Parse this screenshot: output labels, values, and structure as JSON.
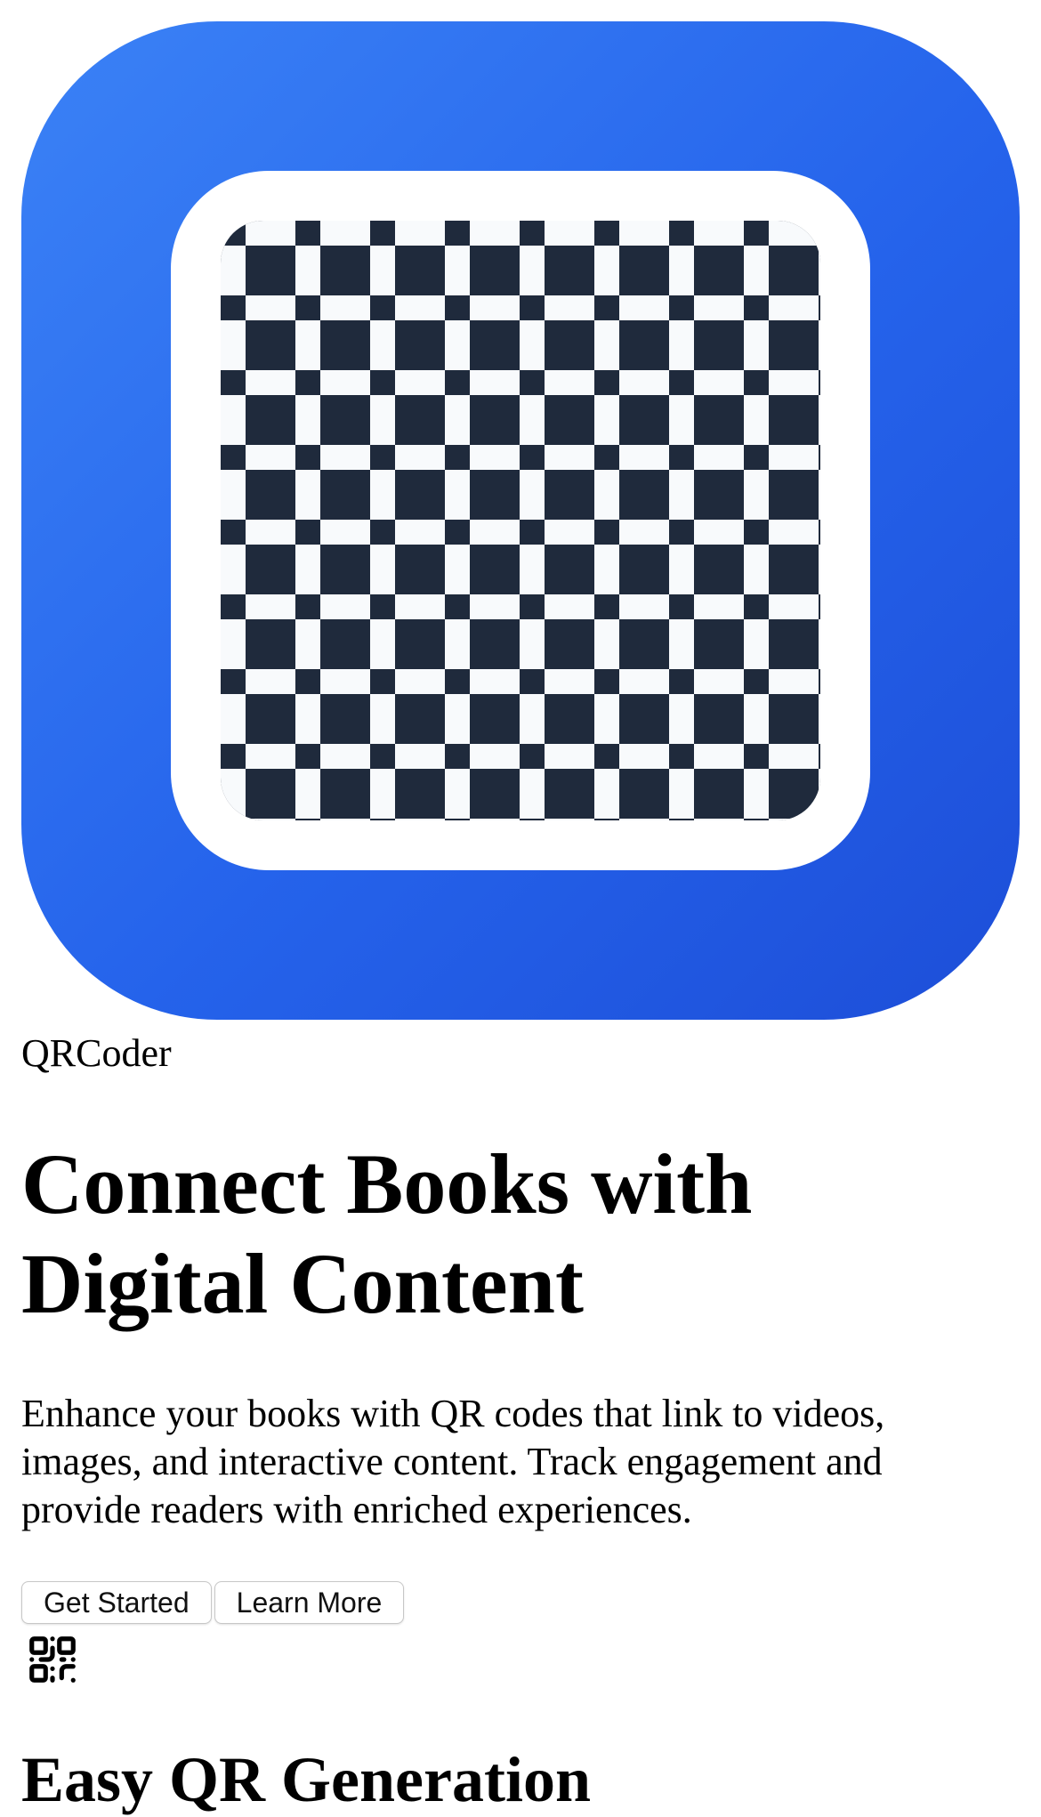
{
  "brand": {
    "name": "QRCoder"
  },
  "hero": {
    "headline": "Connect Books with Digital Content",
    "description": "Enhance your books with QR codes that link to videos, images, and interactive content. Track engagement and provide readers with enriched experiences."
  },
  "actions": {
    "primary_label": "Get Started",
    "secondary_label": "Learn More"
  },
  "features": {
    "first_title": "Easy QR Generation"
  },
  "icons": {
    "app_icon": "qr-app-icon",
    "feature_icon": "qr-code-icon"
  },
  "colors": {
    "icon_gradient_start": "#3b82f6",
    "icon_gradient_end": "#1d4ed8",
    "qr_dark": "#1f2a3c",
    "qr_light": "#f8fafc"
  }
}
